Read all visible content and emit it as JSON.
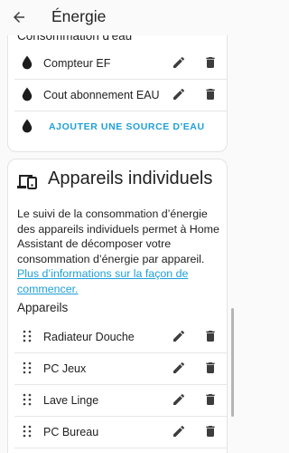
{
  "header": {
    "title": "Énergie"
  },
  "water": {
    "section_title": "Consommation d'eau",
    "sources": [
      {
        "label": "Compteur EF"
      },
      {
        "label": "Cout abonnement EAU"
      }
    ],
    "add_label": "AJOUTER UNE SOURCE D'EAU"
  },
  "devices": {
    "title": "Appareils individuels",
    "description": "Le suivi de la consommation d’énergie des appareils individuels permet à Home Assistant de décomposer votre consommation d’énergie par appareil.",
    "link_text": "Plus d’informations sur la façon de commencer.",
    "subhead": "Appareils",
    "items": [
      {
        "label": "Radiateur Douche"
      },
      {
        "label": "PC Jeux"
      },
      {
        "label": "Lave Linge"
      },
      {
        "label": "PC Bureau"
      }
    ]
  },
  "colors": {
    "accent": "#1fa0d8",
    "icon": "#3d3d3d",
    "water_icon": "#1c1c1c"
  }
}
